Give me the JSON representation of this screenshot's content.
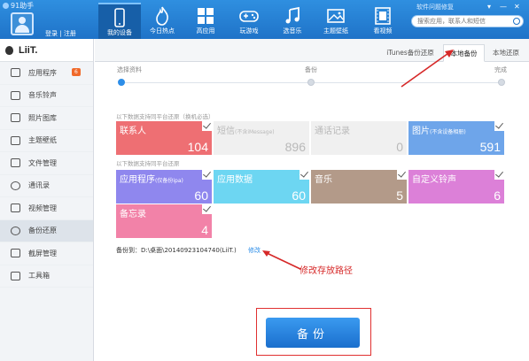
{
  "app": {
    "name": "91助手"
  },
  "header": {
    "login": "登录",
    "separator": "|",
    "register": "注册",
    "notice": "软件问题修复",
    "search_placeholder": "搜索应用，联系人和短信",
    "win_controls": [
      "▾",
      "—",
      "✕"
    ],
    "nav": [
      {
        "label": "我的设备",
        "icon": "phone-icon",
        "active": true
      },
      {
        "label": "今日热点",
        "icon": "flame-icon"
      },
      {
        "label": "高应用",
        "icon": "apps-grid-icon"
      },
      {
        "label": "玩游戏",
        "icon": "gamepad-icon"
      },
      {
        "label": "选音乐",
        "icon": "music-note-icon"
      },
      {
        "label": "主题壁纸",
        "icon": "picture-icon"
      },
      {
        "label": "看视频",
        "icon": "film-icon"
      }
    ]
  },
  "sidebar": {
    "device_name": "LiiT.",
    "items": [
      {
        "label": "应用程序",
        "icon": "apps-icon",
        "badge": "6"
      },
      {
        "label": "音乐铃声",
        "icon": "music-icon"
      },
      {
        "label": "照片图库",
        "icon": "photo-icon"
      },
      {
        "label": "主题壁纸",
        "icon": "wallpaper-icon"
      },
      {
        "label": "文件管理",
        "icon": "folder-icon"
      },
      {
        "label": "通讯录",
        "icon": "contacts-icon"
      },
      {
        "label": "视频管理",
        "icon": "video-icon"
      },
      {
        "label": "备份还原",
        "icon": "backup-icon",
        "active": true
      },
      {
        "label": "截屏管理",
        "icon": "screenshot-icon"
      },
      {
        "label": "工具箱",
        "icon": "toolbox-icon"
      }
    ]
  },
  "subtabs": {
    "itunes": "iTunes备份还原",
    "local_backup": "本地备份",
    "local_restore": "本地还原"
  },
  "steps": [
    "选择资料",
    "备份",
    "完成"
  ],
  "section1_hint": "以下数据支持同平台还原（换机必选）",
  "section2_hint": "以下数据支持同平台还原",
  "tiles1": [
    {
      "name": "联系人",
      "sub": "",
      "count": "104",
      "color": "#ee6f73",
      "checked": true,
      "disabled": false
    },
    {
      "name": "短信",
      "sub": "(不含iMessage)",
      "count": "896",
      "color": "#f0f0f0",
      "checked": false,
      "disabled": true
    },
    {
      "name": "通话记录",
      "sub": "",
      "count": "0",
      "color": "#f0f0f0",
      "checked": false,
      "disabled": true
    },
    {
      "name": "图片",
      "sub": "(不含设备相册)",
      "count": "591",
      "color": "#6ea5ea",
      "checked": true,
      "disabled": false
    }
  ],
  "tiles2": [
    {
      "name": "应用程序",
      "sub": "(仅备份ipa)",
      "count": "60",
      "color": "#8f87ee",
      "checked": true
    },
    {
      "name": "应用数据",
      "sub": "",
      "count": "60",
      "color": "#6dd6f2",
      "checked": true
    },
    {
      "name": "音乐",
      "sub": "",
      "count": "5",
      "color": "#b39a89",
      "checked": true
    },
    {
      "name": "自定义铃声",
      "sub": "",
      "count": "6",
      "color": "#dc80d8",
      "checked": true
    },
    {
      "name": "备忘录",
      "sub": "",
      "count": "4",
      "color": "#f282a8",
      "checked": true
    }
  ],
  "backup_path": {
    "label": "备份到：",
    "value": "D:\\桌面\\20140923104740(LiiT.)",
    "edit": "修改"
  },
  "annotation": "修改存放路径",
  "backup_button": "备份"
}
